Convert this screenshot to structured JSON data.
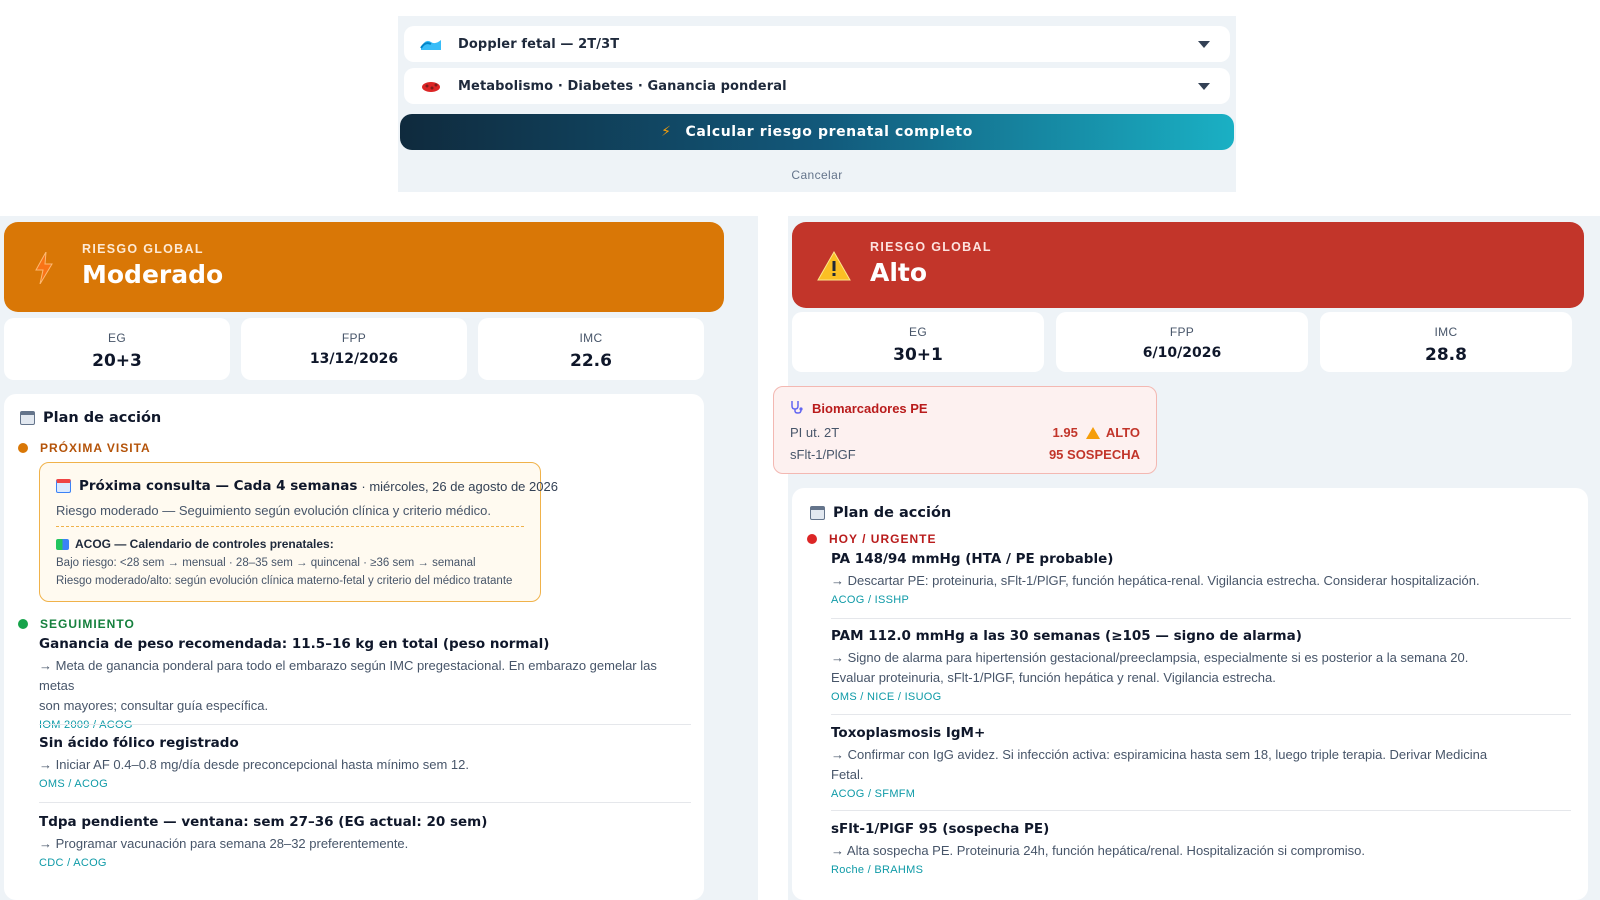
{
  "top_form": {
    "accordions": [
      {
        "label": "Doppler fetal — 2T/3T",
        "icon": "doppler-wave-icon"
      },
      {
        "label": "Metabolismo · Diabetes · Ganancia ponderal",
        "icon": "metabolism-icon"
      }
    ],
    "calc_button": "Calcular riesgo prenatal completo",
    "cancel": "Cancelar"
  },
  "left": {
    "risk": {
      "eyebrow": "RIESGO GLOBAL",
      "level": "Moderado",
      "color": "#d97706",
      "icon": "lightning-icon"
    },
    "stats": [
      {
        "label": "EG",
        "value": "20+3"
      },
      {
        "label": "FPP",
        "value": "13/12/2026"
      },
      {
        "label": "IMC",
        "value": "22.6"
      }
    ],
    "plan": {
      "title": "Plan de acción",
      "next_visit_heading": "PRÓXIMA VISITA",
      "next_visit": {
        "title": "Próxima consulta — Cada 4 semanas",
        "date": "· miércoles, 26 de agosto de 2026",
        "subtitle": "Riesgo moderado — Seguimiento según evolución clínica y criterio médico.",
        "acog_title": "ACOG — Calendario de controles prenatales:",
        "line1": "Bajo riesgo: <28 sem → mensual · 28–35 sem → quincenal · ≥36 sem → semanal",
        "line2": "Riesgo moderado/alto: según evolución clínica materno-fetal y criterio del médico tratante"
      },
      "follow_heading": "SEGUIMIENTO",
      "items": [
        {
          "title": "Ganancia de peso recomendada: 11.5–16 kg en total (peso normal)",
          "desc1": "→ Meta de ganancia ponderal para todo el embarazo según IMC pregestacional. En embarazo gemelar las metas",
          "desc2": "son mayores; consultar guía específica.",
          "source": "IOM 2009 / ACOG"
        },
        {
          "title": "Sin ácido fólico registrado",
          "desc1": "→ Iniciar AF 0.4–0.8 mg/día desde preconcepcional hasta mínimo sem 12.",
          "source": "OMS / ACOG"
        },
        {
          "title": "Tdpa pendiente — ventana: sem 27–36 (EG actual: 20 sem)",
          "desc1": "→ Programar vacunación para semana 28–32 preferentemente.",
          "source": "CDC / ACOG"
        }
      ]
    }
  },
  "right": {
    "risk": {
      "eyebrow": "RIESGO GLOBAL",
      "level": "Alto",
      "color": "#c2352a",
      "icon": "warning-icon"
    },
    "stats": [
      {
        "label": "EG",
        "value": "30+1"
      },
      {
        "label": "FPP",
        "value": "6/10/2026"
      },
      {
        "label": "IMC",
        "value": "28.8"
      }
    ],
    "biomarkers": {
      "title": "Biomarcadores PE",
      "rows": [
        {
          "label": "PI ut. 2T",
          "value": "1.95",
          "flag": "ALTO"
        },
        {
          "label": "sFlt-1/PlGF",
          "value": "95 SOSPECHA"
        }
      ]
    },
    "plan": {
      "title": "Plan de acción",
      "urgent_heading": "HOY / URGENTE",
      "items": [
        {
          "title": "PA 148/94 mmHg (HTA / PE probable)",
          "desc1": "→ Descartar PE: proteinuria, sFlt-1/PlGF, función hepática-renal. Vigilancia estrecha. Considerar hospitalización.",
          "source": "ACOG / ISSHP"
        },
        {
          "title": "PAM 112.0 mmHg a las 30 semanas (≥105 — signo de alarma)",
          "desc1": "→ Signo de alarma para hipertensión gestacional/preeclampsia, especialmente si es posterior a la semana 20.",
          "desc2": "Evaluar proteinuria, sFlt-1/PlGF, función hepática y renal. Vigilancia estrecha.",
          "source": "OMS / NICE / ISUOG"
        },
        {
          "title": "Toxoplasmosis IgM+",
          "desc1": "→ Confirmar con IgG avidez. Si infección activa: espiramicina hasta sem 18, luego triple terapia. Derivar Medicina",
          "desc2": "Fetal.",
          "source": "ACOG / SFMFM"
        },
        {
          "title": "sFlt-1/PlGF 95 (sospecha PE)",
          "desc1": "→ Alta sospecha PE. Proteinuria 24h, función hepática/renal. Hospitalización si compromiso.",
          "source": "Roche / BRAHMS"
        }
      ]
    }
  }
}
